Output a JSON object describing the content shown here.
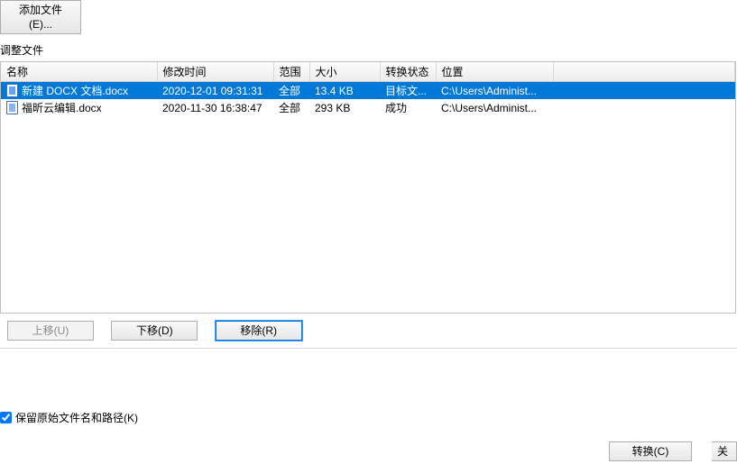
{
  "toolbar": {
    "add_file_label": "添加文件(E)..."
  },
  "section_title": "调整文件",
  "columns": {
    "name": "名称",
    "mtime": "修改时间",
    "range": "范围",
    "size": "大小",
    "status": "转换状态",
    "location": "位置"
  },
  "rows": [
    {
      "name": "新建 DOCX 文档.docx",
      "mtime": "2020-12-01 09:31:31",
      "range": "全部",
      "size": "13.4 KB",
      "status": "目标文...",
      "location": "C:\\Users\\Administ...",
      "selected": true
    },
    {
      "name": "福昕云编辑.docx",
      "mtime": "2020-11-30 16:38:47",
      "range": "全部",
      "size": "293 KB",
      "status": "成功",
      "location": "C:\\Users\\Administ...",
      "selected": false
    }
  ],
  "buttons": {
    "move_up": "上移(U)",
    "move_down": "下移(D)",
    "remove": "移除(R)",
    "convert": "转换(C)",
    "close": "关"
  },
  "checkbox": {
    "keep_orig_path": "保留原始文件名和路径(K)"
  }
}
